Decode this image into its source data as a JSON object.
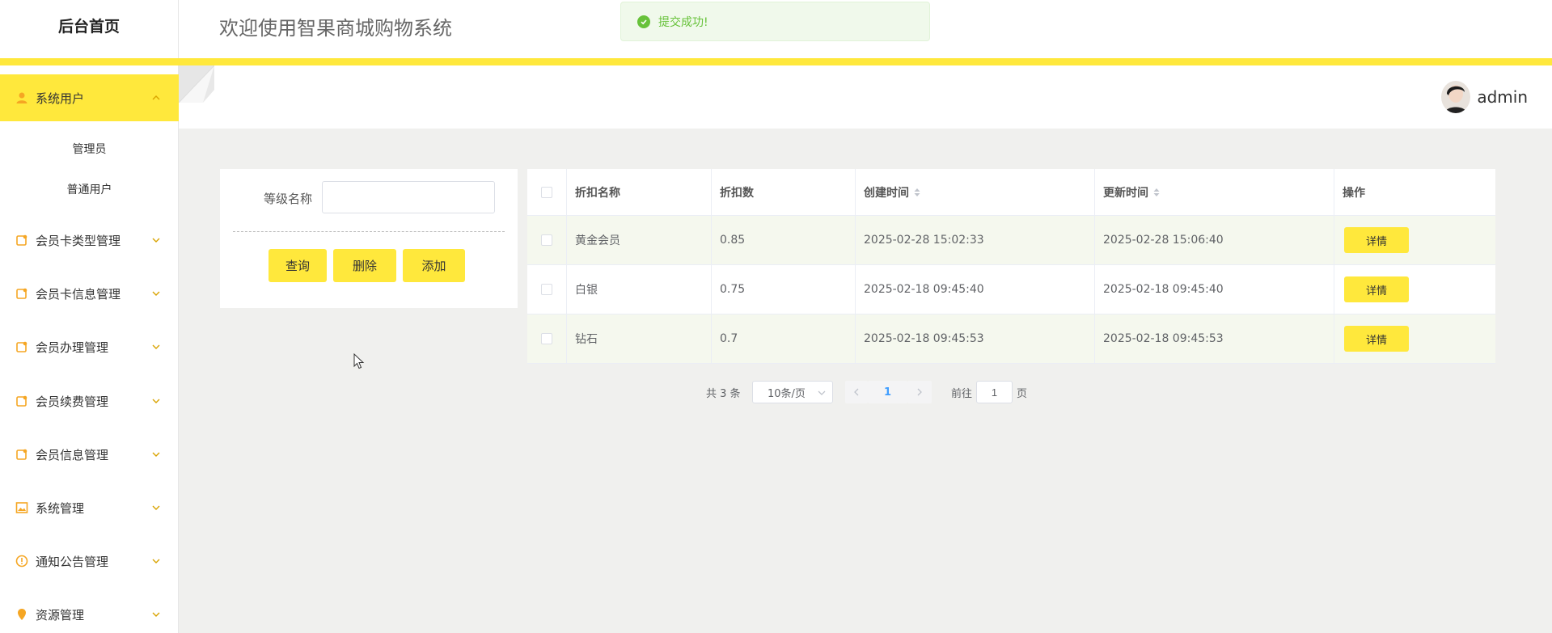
{
  "sidebar": {
    "brand": "后台首页",
    "menu": [
      {
        "label": "系统用户",
        "icon": "user-icon",
        "active": true
      },
      {
        "label": "会员卡类型管理",
        "icon": "doc-icon"
      },
      {
        "label": "会员卡信息管理",
        "icon": "doc-icon"
      },
      {
        "label": "会员办理管理",
        "icon": "doc-icon"
      },
      {
        "label": "会员续费管理",
        "icon": "doc-icon"
      },
      {
        "label": "会员信息管理",
        "icon": "doc-icon"
      },
      {
        "label": "系统管理",
        "icon": "image-icon"
      },
      {
        "label": "通知公告管理",
        "icon": "info-icon"
      },
      {
        "label": "资源管理",
        "icon": "pin-icon"
      }
    ],
    "submenu": [
      "管理员",
      "普通用户"
    ]
  },
  "header": {
    "welcome": "欢迎使用智果商城购物系统",
    "username": "admin"
  },
  "toast": {
    "message": "提交成功!"
  },
  "search": {
    "label": "等级名称",
    "value": "",
    "query_label": "查询",
    "delete_label": "删除",
    "add_label": "添加"
  },
  "table": {
    "headers": [
      "折扣名称",
      "折扣数",
      "创建时间",
      "更新时间",
      "操作"
    ],
    "rows": [
      {
        "name": "黄金会员",
        "discount": "0.85",
        "created": "2025-02-28 15:02:33",
        "updated": "2025-02-28 15:06:40",
        "action": "详情"
      },
      {
        "name": "白银",
        "discount": "0.75",
        "created": "2025-02-18 09:45:40",
        "updated": "2025-02-18 09:45:40",
        "action": "详情"
      },
      {
        "name": "钻石",
        "discount": "0.7",
        "created": "2025-02-18 09:45:53",
        "updated": "2025-02-18 09:45:53",
        "action": "详情"
      }
    ]
  },
  "pagination": {
    "total": "共 3 条",
    "page_size": "10条/页",
    "current_page": "1",
    "goto_prefix": "前往",
    "goto_value": "1",
    "goto_suffix": "页"
  },
  "colors": {
    "accent": "#ffe83c",
    "success": "#67c23a",
    "row_highlight": "#f5f8ee"
  }
}
